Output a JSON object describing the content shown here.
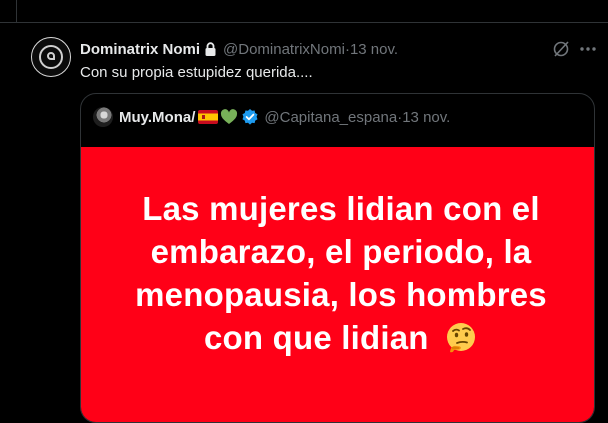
{
  "tweet": {
    "display_name": "Dominatrix Nomi",
    "handle": "@DominatrixNomi",
    "date": "13 nov.",
    "text": "Con su propia estupidez querida....",
    "icons": {
      "lock": "lock-icon",
      "grok": "grok-icon",
      "more": "more-icon"
    }
  },
  "quote": {
    "display_name": "Muy.Mona/",
    "handle": "@Capitana_espana",
    "date": "13 nov.",
    "icons": {
      "flag": "spain-flag-icon",
      "heart": "green-heart-icon",
      "verified": "verified-badge-icon"
    },
    "media": {
      "text": "Las mujeres lidian con el embarazo, el periodo, la menopausia, los hombres con que lidian",
      "emoji_icon": "thinking-face-icon",
      "background_color": "#ff0017",
      "text_color": "#ffffff"
    }
  },
  "separator": " · "
}
